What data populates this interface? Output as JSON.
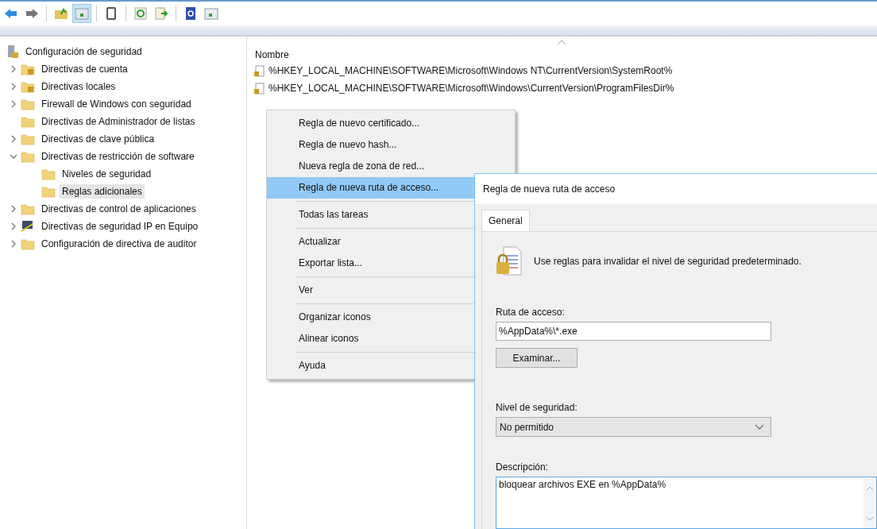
{
  "toolbar": {
    "buttons": [
      {
        "kind": "back",
        "pressed": false
      },
      {
        "kind": "forward",
        "pressed": false
      },
      {
        "kind": "up-folder",
        "pressed": false
      },
      {
        "kind": "show-tree",
        "pressed": true
      },
      {
        "kind": "clipboard",
        "pressed": false
      },
      {
        "kind": "refresh",
        "pressed": false
      },
      {
        "kind": "export",
        "pressed": false
      },
      {
        "kind": "help",
        "pressed": false
      },
      {
        "kind": "panel",
        "pressed": false
      }
    ]
  },
  "tree": {
    "root": {
      "label": "Configuración de seguridad",
      "kind": "server"
    },
    "items": [
      {
        "label": "Directivas de cuenta",
        "kind": "locked",
        "expanded": false,
        "selected": false
      },
      {
        "label": "Directivas locales",
        "kind": "locked",
        "expanded": false,
        "selected": false
      },
      {
        "label": "Firewall de Windows con seguridad",
        "kind": "folder",
        "expanded": false,
        "selected": false
      },
      {
        "label": "Directivas de Administrador de listas",
        "kind": "folder",
        "selected": false
      },
      {
        "label": "Directivas de clave pública",
        "kind": "folder",
        "expanded": false,
        "selected": false
      },
      {
        "label": "Directivas de restricción de software",
        "kind": "folder",
        "expanded": true,
        "selected": false,
        "children": [
          {
            "label": "Niveles de seguridad",
            "kind": "folder",
            "selected": false
          },
          {
            "label": "Reglas adicionales",
            "kind": "folder",
            "selected": true
          }
        ]
      },
      {
        "label": "Directivas de control de aplicaciones",
        "kind": "folder",
        "expanded": false,
        "selected": false
      },
      {
        "label": "Directivas de seguridad IP en Equipo",
        "kind": "network",
        "expanded": false,
        "selected": false
      },
      {
        "label": "Configuración de directiva de auditor",
        "kind": "folder",
        "expanded": false,
        "selected": false
      }
    ]
  },
  "list": {
    "column": "Nombre",
    "rows": [
      {
        "name": "%HKEY_LOCAL_MACHINE\\SOFTWARE\\Microsoft\\Windows NT\\CurrentVersion\\SystemRoot%"
      },
      {
        "name": "%HKEY_LOCAL_MACHINE\\SOFTWARE\\Microsoft\\Windows\\CurrentVersion\\ProgramFilesDir%"
      }
    ]
  },
  "context_menu": {
    "items": [
      {
        "kind": "item",
        "label": "Regla de nuevo certificado...",
        "selected": false
      },
      {
        "kind": "item",
        "label": "Regla de nuevo hash...",
        "selected": false
      },
      {
        "kind": "item",
        "label": "Nueva regla de zona de red...",
        "selected": false
      },
      {
        "kind": "item",
        "label": "Regla de nueva ruta de acceso...",
        "selected": true
      },
      {
        "kind": "separator"
      },
      {
        "kind": "item",
        "label": "Todas las tareas",
        "selected": false
      },
      {
        "kind": "separator"
      },
      {
        "kind": "item",
        "label": "Actualizar",
        "selected": false
      },
      {
        "kind": "item",
        "label": "Exportar lista...",
        "selected": false
      },
      {
        "kind": "separator"
      },
      {
        "kind": "item",
        "label": "Ver",
        "selected": false
      },
      {
        "kind": "separator"
      },
      {
        "kind": "item",
        "label": "Organizar iconos",
        "selected": false
      },
      {
        "kind": "item",
        "label": "Alinear iconos",
        "selected": false
      },
      {
        "kind": "separator"
      },
      {
        "kind": "item",
        "label": "Ayuda",
        "selected": false
      }
    ]
  },
  "dialog": {
    "title": "Regla de nueva ruta de acceso",
    "tabs": [
      {
        "label": "General",
        "selected": true
      }
    ],
    "info": "Use reglas para invalidar el nivel de seguridad predeterminado.",
    "path_label": "Ruta de acceso:",
    "path_value": "%AppData%\\*.exe",
    "browse_button": "Examinar...",
    "level_label": "Nivel de seguridad:",
    "level_value": "No permitido",
    "description_label": "Descripción:",
    "description_value": "bloquear archivos EXE en %AppData%"
  }
}
